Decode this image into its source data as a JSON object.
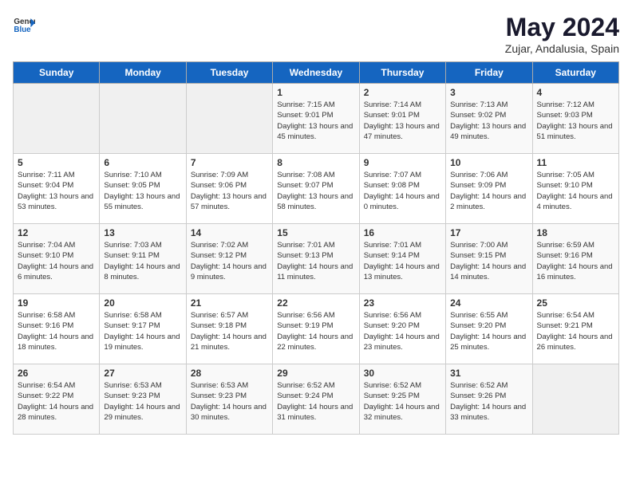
{
  "header": {
    "logo_general": "General",
    "logo_blue": "Blue",
    "title": "May 2024",
    "subtitle": "Zujar, Andalusia, Spain"
  },
  "weekdays": [
    "Sunday",
    "Monday",
    "Tuesday",
    "Wednesday",
    "Thursday",
    "Friday",
    "Saturday"
  ],
  "weeks": [
    [
      {
        "day": "",
        "sunrise": "",
        "sunset": "",
        "daylight": "",
        "empty": true
      },
      {
        "day": "",
        "sunrise": "",
        "sunset": "",
        "daylight": "",
        "empty": true
      },
      {
        "day": "",
        "sunrise": "",
        "sunset": "",
        "daylight": "",
        "empty": true
      },
      {
        "day": "1",
        "sunrise": "Sunrise: 7:15 AM",
        "sunset": "Sunset: 9:01 PM",
        "daylight": "Daylight: 13 hours and 45 minutes."
      },
      {
        "day": "2",
        "sunrise": "Sunrise: 7:14 AM",
        "sunset": "Sunset: 9:01 PM",
        "daylight": "Daylight: 13 hours and 47 minutes."
      },
      {
        "day": "3",
        "sunrise": "Sunrise: 7:13 AM",
        "sunset": "Sunset: 9:02 PM",
        "daylight": "Daylight: 13 hours and 49 minutes."
      },
      {
        "day": "4",
        "sunrise": "Sunrise: 7:12 AM",
        "sunset": "Sunset: 9:03 PM",
        "daylight": "Daylight: 13 hours and 51 minutes."
      }
    ],
    [
      {
        "day": "5",
        "sunrise": "Sunrise: 7:11 AM",
        "sunset": "Sunset: 9:04 PM",
        "daylight": "Daylight: 13 hours and 53 minutes."
      },
      {
        "day": "6",
        "sunrise": "Sunrise: 7:10 AM",
        "sunset": "Sunset: 9:05 PM",
        "daylight": "Daylight: 13 hours and 55 minutes."
      },
      {
        "day": "7",
        "sunrise": "Sunrise: 7:09 AM",
        "sunset": "Sunset: 9:06 PM",
        "daylight": "Daylight: 13 hours and 57 minutes."
      },
      {
        "day": "8",
        "sunrise": "Sunrise: 7:08 AM",
        "sunset": "Sunset: 9:07 PM",
        "daylight": "Daylight: 13 hours and 58 minutes."
      },
      {
        "day": "9",
        "sunrise": "Sunrise: 7:07 AM",
        "sunset": "Sunset: 9:08 PM",
        "daylight": "Daylight: 14 hours and 0 minutes."
      },
      {
        "day": "10",
        "sunrise": "Sunrise: 7:06 AM",
        "sunset": "Sunset: 9:09 PM",
        "daylight": "Daylight: 14 hours and 2 minutes."
      },
      {
        "day": "11",
        "sunrise": "Sunrise: 7:05 AM",
        "sunset": "Sunset: 9:10 PM",
        "daylight": "Daylight: 14 hours and 4 minutes."
      }
    ],
    [
      {
        "day": "12",
        "sunrise": "Sunrise: 7:04 AM",
        "sunset": "Sunset: 9:10 PM",
        "daylight": "Daylight: 14 hours and 6 minutes."
      },
      {
        "day": "13",
        "sunrise": "Sunrise: 7:03 AM",
        "sunset": "Sunset: 9:11 PM",
        "daylight": "Daylight: 14 hours and 8 minutes."
      },
      {
        "day": "14",
        "sunrise": "Sunrise: 7:02 AM",
        "sunset": "Sunset: 9:12 PM",
        "daylight": "Daylight: 14 hours and 9 minutes."
      },
      {
        "day": "15",
        "sunrise": "Sunrise: 7:01 AM",
        "sunset": "Sunset: 9:13 PM",
        "daylight": "Daylight: 14 hours and 11 minutes."
      },
      {
        "day": "16",
        "sunrise": "Sunrise: 7:01 AM",
        "sunset": "Sunset: 9:14 PM",
        "daylight": "Daylight: 14 hours and 13 minutes."
      },
      {
        "day": "17",
        "sunrise": "Sunrise: 7:00 AM",
        "sunset": "Sunset: 9:15 PM",
        "daylight": "Daylight: 14 hours and 14 minutes."
      },
      {
        "day": "18",
        "sunrise": "Sunrise: 6:59 AM",
        "sunset": "Sunset: 9:16 PM",
        "daylight": "Daylight: 14 hours and 16 minutes."
      }
    ],
    [
      {
        "day": "19",
        "sunrise": "Sunrise: 6:58 AM",
        "sunset": "Sunset: 9:16 PM",
        "daylight": "Daylight: 14 hours and 18 minutes."
      },
      {
        "day": "20",
        "sunrise": "Sunrise: 6:58 AM",
        "sunset": "Sunset: 9:17 PM",
        "daylight": "Daylight: 14 hours and 19 minutes."
      },
      {
        "day": "21",
        "sunrise": "Sunrise: 6:57 AM",
        "sunset": "Sunset: 9:18 PM",
        "daylight": "Daylight: 14 hours and 21 minutes."
      },
      {
        "day": "22",
        "sunrise": "Sunrise: 6:56 AM",
        "sunset": "Sunset: 9:19 PM",
        "daylight": "Daylight: 14 hours and 22 minutes."
      },
      {
        "day": "23",
        "sunrise": "Sunrise: 6:56 AM",
        "sunset": "Sunset: 9:20 PM",
        "daylight": "Daylight: 14 hours and 23 minutes."
      },
      {
        "day": "24",
        "sunrise": "Sunrise: 6:55 AM",
        "sunset": "Sunset: 9:20 PM",
        "daylight": "Daylight: 14 hours and 25 minutes."
      },
      {
        "day": "25",
        "sunrise": "Sunrise: 6:54 AM",
        "sunset": "Sunset: 9:21 PM",
        "daylight": "Daylight: 14 hours and 26 minutes."
      }
    ],
    [
      {
        "day": "26",
        "sunrise": "Sunrise: 6:54 AM",
        "sunset": "Sunset: 9:22 PM",
        "daylight": "Daylight: 14 hours and 28 minutes."
      },
      {
        "day": "27",
        "sunrise": "Sunrise: 6:53 AM",
        "sunset": "Sunset: 9:23 PM",
        "daylight": "Daylight: 14 hours and 29 minutes."
      },
      {
        "day": "28",
        "sunrise": "Sunrise: 6:53 AM",
        "sunset": "Sunset: 9:23 PM",
        "daylight": "Daylight: 14 hours and 30 minutes."
      },
      {
        "day": "29",
        "sunrise": "Sunrise: 6:52 AM",
        "sunset": "Sunset: 9:24 PM",
        "daylight": "Daylight: 14 hours and 31 minutes."
      },
      {
        "day": "30",
        "sunrise": "Sunrise: 6:52 AM",
        "sunset": "Sunset: 9:25 PM",
        "daylight": "Daylight: 14 hours and 32 minutes."
      },
      {
        "day": "31",
        "sunrise": "Sunrise: 6:52 AM",
        "sunset": "Sunset: 9:26 PM",
        "daylight": "Daylight: 14 hours and 33 minutes."
      },
      {
        "day": "",
        "sunrise": "",
        "sunset": "",
        "daylight": "",
        "empty": true
      }
    ]
  ]
}
